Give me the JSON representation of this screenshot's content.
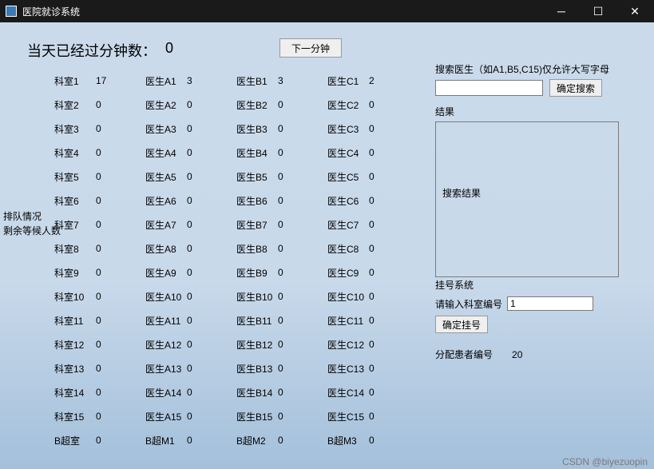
{
  "window": {
    "title": "医院就诊系统"
  },
  "minutes": {
    "label": "当天已经过分钟数：",
    "value": "0"
  },
  "next_button": "下一分钟",
  "side": {
    "line1": "排队情况",
    "line2": "剩余等候人数"
  },
  "rows": [
    {
      "dept": "科室1",
      "dv": "17",
      "a": "医生A1",
      "av": "3",
      "b": "医生B1",
      "bv": "3",
      "c": "医生C1",
      "cv": "2"
    },
    {
      "dept": "科室2",
      "dv": "0",
      "a": "医生A2",
      "av": "0",
      "b": "医生B2",
      "bv": "0",
      "c": "医生C2",
      "cv": "0"
    },
    {
      "dept": "科室3",
      "dv": "0",
      "a": "医生A3",
      "av": "0",
      "b": "医生B3",
      "bv": "0",
      "c": "医生C3",
      "cv": "0"
    },
    {
      "dept": "科室4",
      "dv": "0",
      "a": "医生A4",
      "av": "0",
      "b": "医生B4",
      "bv": "0",
      "c": "医生C4",
      "cv": "0"
    },
    {
      "dept": "科室5",
      "dv": "0",
      "a": "医生A5",
      "av": "0",
      "b": "医生B5",
      "bv": "0",
      "c": "医生C5",
      "cv": "0"
    },
    {
      "dept": "科室6",
      "dv": "0",
      "a": "医生A6",
      "av": "0",
      "b": "医生B6",
      "bv": "0",
      "c": "医生C6",
      "cv": "0"
    },
    {
      "dept": "科室7",
      "dv": "0",
      "a": "医生A7",
      "av": "0",
      "b": "医生B7",
      "bv": "0",
      "c": "医生C7",
      "cv": "0"
    },
    {
      "dept": "科室8",
      "dv": "0",
      "a": "医生A8",
      "av": "0",
      "b": "医生B8",
      "bv": "0",
      "c": "医生C8",
      "cv": "0"
    },
    {
      "dept": "科室9",
      "dv": "0",
      "a": "医生A9",
      "av": "0",
      "b": "医生B9",
      "bv": "0",
      "c": "医生C9",
      "cv": "0"
    },
    {
      "dept": "科室10",
      "dv": "0",
      "a": "医生A10",
      "av": "0",
      "b": "医生B10",
      "bv": "0",
      "c": "医生C10",
      "cv": "0"
    },
    {
      "dept": "科室11",
      "dv": "0",
      "a": "医生A11",
      "av": "0",
      "b": "医生B11",
      "bv": "0",
      "c": "医生C11",
      "cv": "0"
    },
    {
      "dept": "科室12",
      "dv": "0",
      "a": "医生A12",
      "av": "0",
      "b": "医生B12",
      "bv": "0",
      "c": "医生C12",
      "cv": "0"
    },
    {
      "dept": "科室13",
      "dv": "0",
      "a": "医生A13",
      "av": "0",
      "b": "医生B13",
      "bv": "0",
      "c": "医生C13",
      "cv": "0"
    },
    {
      "dept": "科室14",
      "dv": "0",
      "a": "医生A14",
      "av": "0",
      "b": "医生B14",
      "bv": "0",
      "c": "医生C14",
      "cv": "0"
    },
    {
      "dept": "科室15",
      "dv": "0",
      "a": "医生A15",
      "av": "0",
      "b": "医生B15",
      "bv": "0",
      "c": "医生C15",
      "cv": "0"
    },
    {
      "dept": "B超室",
      "dv": "0",
      "a": "B超M1",
      "av": "0",
      "b": "B超M2",
      "bv": "0",
      "c": "B超M3",
      "cv": "0"
    }
  ],
  "search": {
    "hint": "搜索医生（如A1,B5,C15)仅允许大写字母",
    "value": "",
    "button": "确定搜索",
    "result_label": "结果",
    "result_placeholder": "搜索结果"
  },
  "register": {
    "title": "挂号系统",
    "input_label": "请输入科室编号",
    "input_value": "1",
    "button": "确定挂号",
    "assign_label": "分配患者编号",
    "assign_value": "20"
  },
  "watermark": "CSDN @biyezuopin"
}
